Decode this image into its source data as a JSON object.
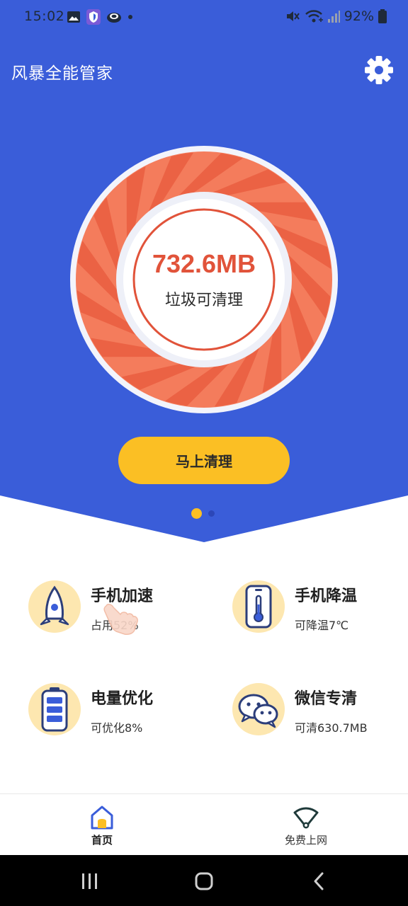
{
  "status_bar": {
    "time": "15:02",
    "battery": "92%"
  },
  "app": {
    "title": "风暴全能管家"
  },
  "cleaner": {
    "amount": "732.6MB",
    "caption": "垃圾可清理",
    "button_label": "马上清理"
  },
  "pager": {
    "total": 2,
    "active": 1
  },
  "features": [
    {
      "title": "手机加速",
      "subtitle": "占用52%",
      "icon": "rocket-icon"
    },
    {
      "title": "手机降温",
      "subtitle": "可降温7℃",
      "icon": "phone-thermometer-icon"
    },
    {
      "title": "电量优化",
      "subtitle": "可优化8%",
      "icon": "battery-icon"
    },
    {
      "title": "微信专清",
      "subtitle": "可清630.7MB",
      "icon": "wechat-icon"
    }
  ],
  "bottom_nav": [
    {
      "label": "首页",
      "icon": "home-icon",
      "active": true
    },
    {
      "label": "免费上网",
      "icon": "wifi-icon",
      "active": false
    }
  ],
  "colors": {
    "primary_blue": "#3a5dd9",
    "accent_yellow": "#fbbf24",
    "ring_orange": "#f26b4b",
    "value_red": "#e1533a"
  }
}
